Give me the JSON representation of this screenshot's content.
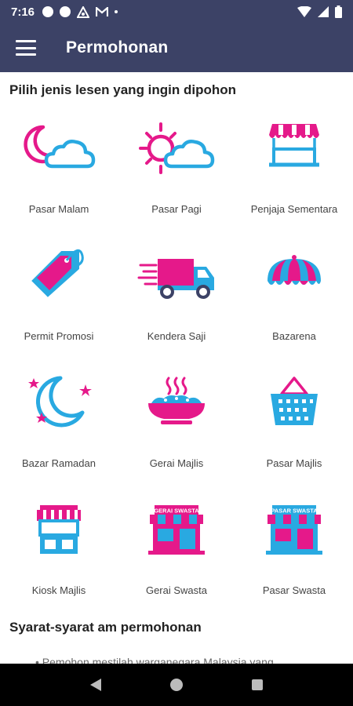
{
  "status_bar": {
    "time": "7:16"
  },
  "app_bar": {
    "title": "Permohonan",
    "menu_icon": "hamburger-menu-icon"
  },
  "colors": {
    "bar": "#3c4266",
    "pink": "#e5198a",
    "blue": "#29a9e1"
  },
  "main": {
    "heading": "Pilih jenis lesen yang ingin dipohon",
    "tiles": [
      {
        "label": "Pasar Malam",
        "icon": "moon-cloud-icon"
      },
      {
        "label": "Pasar Pagi",
        "icon": "sun-cloud-icon"
      },
      {
        "label": "Penjaja Sementara",
        "icon": "vendor-cart-icon"
      },
      {
        "label": "Permit Promosi",
        "icon": "price-tag-icon"
      },
      {
        "label": "Kendera Saji",
        "icon": "delivery-truck-icon"
      },
      {
        "label": "Bazarena",
        "icon": "canopy-icon"
      },
      {
        "label": "Bazar Ramadan",
        "icon": "crescent-stars-icon"
      },
      {
        "label": "Gerai Majlis",
        "icon": "hot-food-bowl-icon"
      },
      {
        "label": "Pasar Majlis",
        "icon": "shopping-basket-icon"
      },
      {
        "label": "Kiosk Majlis",
        "icon": "kiosk-icon"
      },
      {
        "label": "Gerai Swasta",
        "icon": "storefront-icon"
      },
      {
        "label": "Pasar Swasta",
        "icon": "market-store-icon"
      }
    ],
    "sign_gerai": "GERAI SWASTA",
    "sign_pasar": "PASAR SWASTA",
    "requirements_heading": "Syarat-syarat am permohonan",
    "requirements_first": "Pemohon mestilah warganegara Malaysia yang"
  }
}
